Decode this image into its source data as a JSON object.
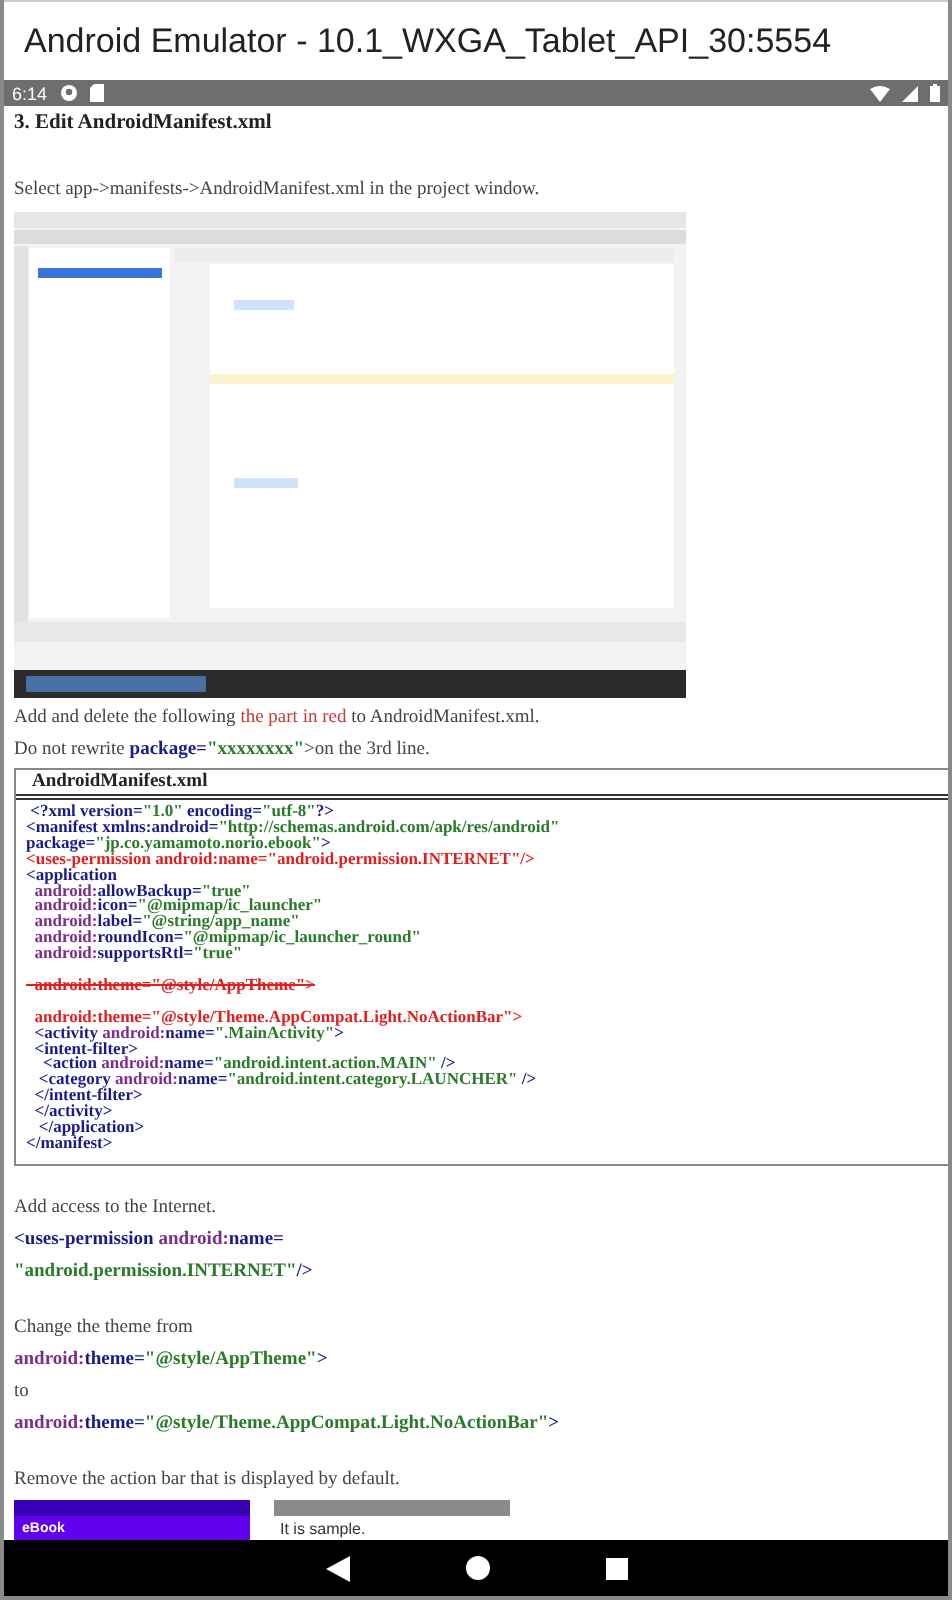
{
  "window": {
    "title": "Android Emulator - 10.1_WXGA_Tablet_API_30:5554"
  },
  "status_bar": {
    "time": "6:14"
  },
  "article": {
    "heading": "3. Edit AndroidManifest.xml",
    "intro": "Select app->manifests->AndroidManifest.xml in the project window.",
    "instruction": [
      {
        "kind": "plain",
        "text": "Add and delete the following "
      },
      {
        "kind": "red",
        "text": "the part in red"
      },
      {
        "kind": "plain",
        "text": " to AndroidManifest.xml."
      }
    ],
    "note": [
      {
        "kind": "plain",
        "text": "Do not rewrite "
      },
      {
        "kind": "tag",
        "text": "package="
      },
      {
        "kind": "value",
        "text": "\"xxxxxxxx\""
      },
      {
        "kind": "plain",
        "text": ">on the 3rd line."
      }
    ],
    "code_box": {
      "title": "AndroidManifest.xml",
      "blocks": [
        [
          [
            {
              "kind": "tag",
              "text": " <?xml version="
            },
            {
              "kind": "value",
              "text": "\"1.0\""
            },
            {
              "kind": "tag",
              "text": " encoding="
            },
            {
              "kind": "value",
              "text": "\"utf-8\""
            },
            {
              "kind": "tag",
              "text": "?>"
            }
          ],
          [
            {
              "kind": "tag",
              "text": "<manifest xmlns:android="
            },
            {
              "kind": "value",
              "text": "\"http://schemas.android.com/apk/res/android\""
            }
          ],
          [
            {
              "kind": "tag",
              "text": "package="
            },
            {
              "kind": "value",
              "text": "\"jp.co.yamamoto.norio.ebook\""
            },
            {
              "kind": "tag",
              "text": ">"
            }
          ],
          [
            {
              "kind": "add",
              "text": "<uses-permission android:name=\"android.permission.INTERNET\"/>"
            }
          ],
          [
            {
              "kind": "tag",
              "text": "<application"
            }
          ],
          [
            {
              "kind": "attr",
              "text": "  android:"
            },
            {
              "kind": "tag",
              "text": "allowBackup="
            },
            {
              "kind": "value",
              "text": "\"true\""
            }
          ],
          [
            {
              "kind": "attr",
              "text": "  android:"
            },
            {
              "kind": "tag",
              "text": "icon="
            },
            {
              "kind": "value",
              "text": "\"@mipmap/ic_launcher\""
            }
          ],
          [
            {
              "kind": "attr",
              "text": "  android:"
            },
            {
              "kind": "tag",
              "text": "label="
            },
            {
              "kind": "value",
              "text": "\"@string/app_name\""
            }
          ],
          [
            {
              "kind": "attr",
              "text": "  android:"
            },
            {
              "kind": "tag",
              "text": "roundIcon="
            },
            {
              "kind": "value",
              "text": "\"@mipmap/ic_launcher_round\""
            }
          ],
          [
            {
              "kind": "attr",
              "text": "  android:"
            },
            {
              "kind": "tag",
              "text": "supportsRtl="
            },
            {
              "kind": "value",
              "text": "\"true\""
            }
          ]
        ],
        [
          [
            {
              "kind": "del",
              "text": "  android:theme=\"@style/AppTheme\">"
            }
          ]
        ],
        [
          [
            {
              "kind": "add",
              "text": "  android:theme=\"@style/Theme.AppCompat.Light.NoActionBar\">"
            }
          ],
          [
            {
              "kind": "tag",
              "text": "  <activity "
            },
            {
              "kind": "attr",
              "text": "android:"
            },
            {
              "kind": "tag",
              "text": "name="
            },
            {
              "kind": "value",
              "text": "\".MainActivity\""
            },
            {
              "kind": "tag",
              "text": ">"
            }
          ],
          [
            {
              "kind": "tag",
              "text": "  <intent-filter>"
            }
          ],
          [
            {
              "kind": "tag",
              "text": "    <action "
            },
            {
              "kind": "attr",
              "text": "android:"
            },
            {
              "kind": "tag",
              "text": "name="
            },
            {
              "kind": "value",
              "text": "\"android.intent.action.MAIN\""
            },
            {
              "kind": "tag",
              "text": " />"
            }
          ],
          [
            {
              "kind": "tag",
              "text": "   <category "
            },
            {
              "kind": "attr",
              "text": "android:"
            },
            {
              "kind": "tag",
              "text": "name="
            },
            {
              "kind": "value",
              "text": "\"android.intent.category.LAUNCHER\""
            },
            {
              "kind": "tag",
              "text": " />"
            }
          ],
          [
            {
              "kind": "tag",
              "text": "  </intent-filter>"
            }
          ],
          [
            {
              "kind": "tag",
              "text": "  </activity>"
            }
          ],
          [
            {
              "kind": "tag",
              "text": "   </application>"
            }
          ],
          [
            {
              "kind": "tag",
              "text": "</manifest>"
            }
          ]
        ]
      ]
    },
    "sections": [
      [
        [
          {
            "kind": "plain",
            "text": "Add access to the Internet."
          }
        ],
        [
          {
            "kind": "tag",
            "text": "<uses-permission "
          },
          {
            "kind": "attr",
            "text": "android:"
          },
          {
            "kind": "tag",
            "text": "name="
          }
        ],
        [
          {
            "kind": "value",
            "text": "\"android.permission.INTERNET\""
          },
          {
            "kind": "tag",
            "text": "/>"
          }
        ]
      ],
      [
        [
          {
            "kind": "plain",
            "text": "Change the theme from"
          }
        ],
        [
          {
            "kind": "attr",
            "text": "android:"
          },
          {
            "kind": "tag",
            "text": "theme="
          },
          {
            "kind": "value",
            "text": "\"@style/AppTheme\""
          },
          {
            "kind": "tag",
            "text": ">"
          }
        ],
        [
          {
            "kind": "plain",
            "text": "to"
          }
        ],
        [
          {
            "kind": "attr",
            "text": "android:"
          },
          {
            "kind": "tag",
            "text": "theme="
          },
          {
            "kind": "value",
            "text": "\"@style/Theme.AppCompat.Light.NoActionBar\""
          },
          {
            "kind": "tag",
            "text": ">"
          }
        ]
      ],
      [
        [
          {
            "kind": "plain",
            "text": "Remove the action bar that is displayed by default."
          }
        ]
      ]
    ],
    "sample_screens": [
      {
        "kind": "action_bar",
        "text": "eBook"
      },
      {
        "kind": "plain",
        "text": "It is sample."
      }
    ]
  }
}
